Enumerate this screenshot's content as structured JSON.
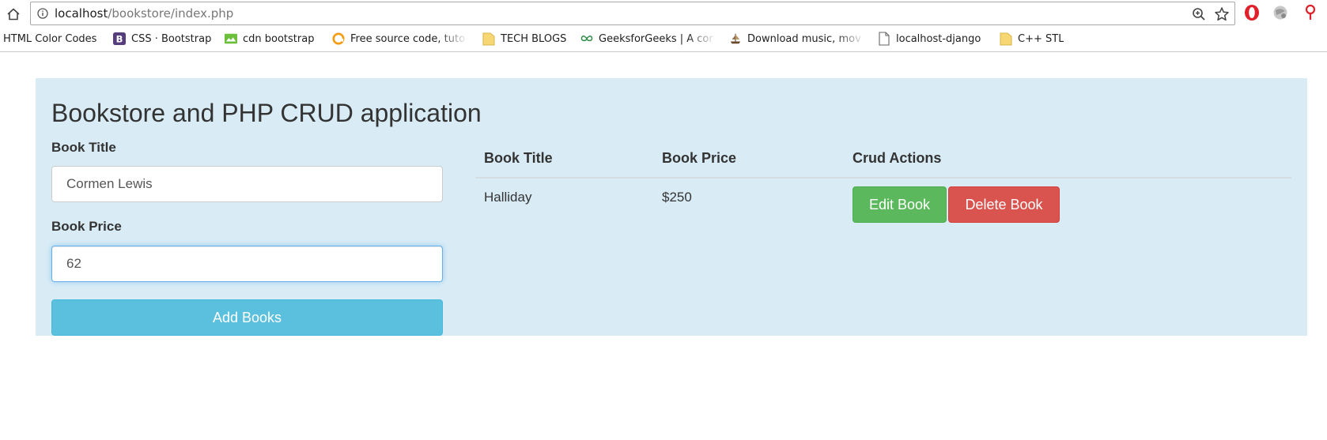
{
  "browser": {
    "url_host": "localhost",
    "url_path": "/bookstore/index.php",
    "bookmarks": [
      {
        "label": "HTML Color Codes",
        "icon": "none"
      },
      {
        "label": "CSS · Bootstrap",
        "icon": "bootstrap-icon"
      },
      {
        "label": "cdn bootstrap",
        "icon": "image-icon"
      },
      {
        "label": "Free source code, tuto",
        "icon": "refresh-logo-icon"
      },
      {
        "label": "TECH BLOGS",
        "icon": "folder-icon"
      },
      {
        "label": "GeeksforGeeks | A cor",
        "icon": "gfg-icon"
      },
      {
        "label": "Download music, mov",
        "icon": "pirate-ship-icon"
      },
      {
        "label": "localhost-django",
        "icon": "page-icon"
      },
      {
        "label": "C++ STL",
        "icon": "folder-icon"
      }
    ]
  },
  "page": {
    "title": "Bookstore and PHP CRUD application",
    "form": {
      "title_label": "Book Title",
      "title_value": "Cormen Lewis",
      "price_label": "Book Price",
      "price_value": "62",
      "add_button": "Add Books"
    },
    "table": {
      "headers": [
        "Book Title",
        "Book Price",
        "Crud Actions"
      ],
      "rows": [
        {
          "title": "Halliday",
          "price": "$250",
          "edit_label": "Edit Book",
          "delete_label": "Delete Book"
        }
      ]
    }
  },
  "colors": {
    "jumbotron": "#d9ecf6",
    "info_button": "#5bc0de",
    "success_button": "#5cb85c",
    "danger_button": "#d9534f"
  }
}
